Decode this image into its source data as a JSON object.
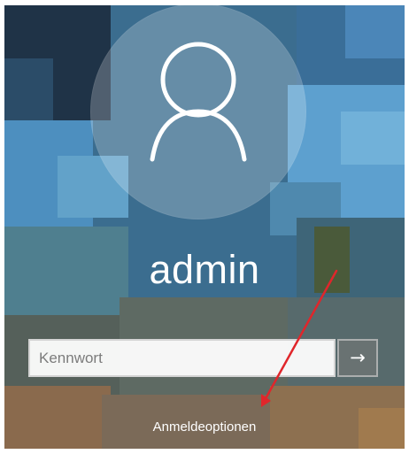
{
  "user": {
    "name": "admin"
  },
  "password": {
    "placeholder": "Kennwort"
  },
  "submit": {
    "icon": "arrow-right-icon",
    "glyph": "→"
  },
  "sign_in_options": {
    "label": "Anmeldeoptionen"
  },
  "annotation": {
    "color": "#e0262b"
  }
}
